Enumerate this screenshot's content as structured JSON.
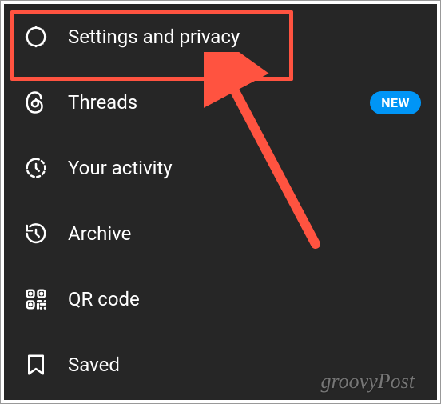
{
  "menu": {
    "items": [
      {
        "label": "Settings and privacy",
        "icon": "gear-icon",
        "badge": null,
        "highlighted": true
      },
      {
        "label": "Threads",
        "icon": "threads-icon",
        "badge": "NEW",
        "highlighted": false
      },
      {
        "label": "Your activity",
        "icon": "activity-icon",
        "badge": null,
        "highlighted": false
      },
      {
        "label": "Archive",
        "icon": "archive-icon",
        "badge": null,
        "highlighted": false
      },
      {
        "label": "QR code",
        "icon": "qr-code-icon",
        "badge": null,
        "highlighted": false
      },
      {
        "label": "Saved",
        "icon": "saved-icon",
        "badge": null,
        "highlighted": false
      }
    ]
  },
  "watermark": "groovyPost",
  "annotation": {
    "highlight_color": "#ff5340",
    "arrow_color": "#ff5340",
    "badge_color": "#0095f6"
  }
}
